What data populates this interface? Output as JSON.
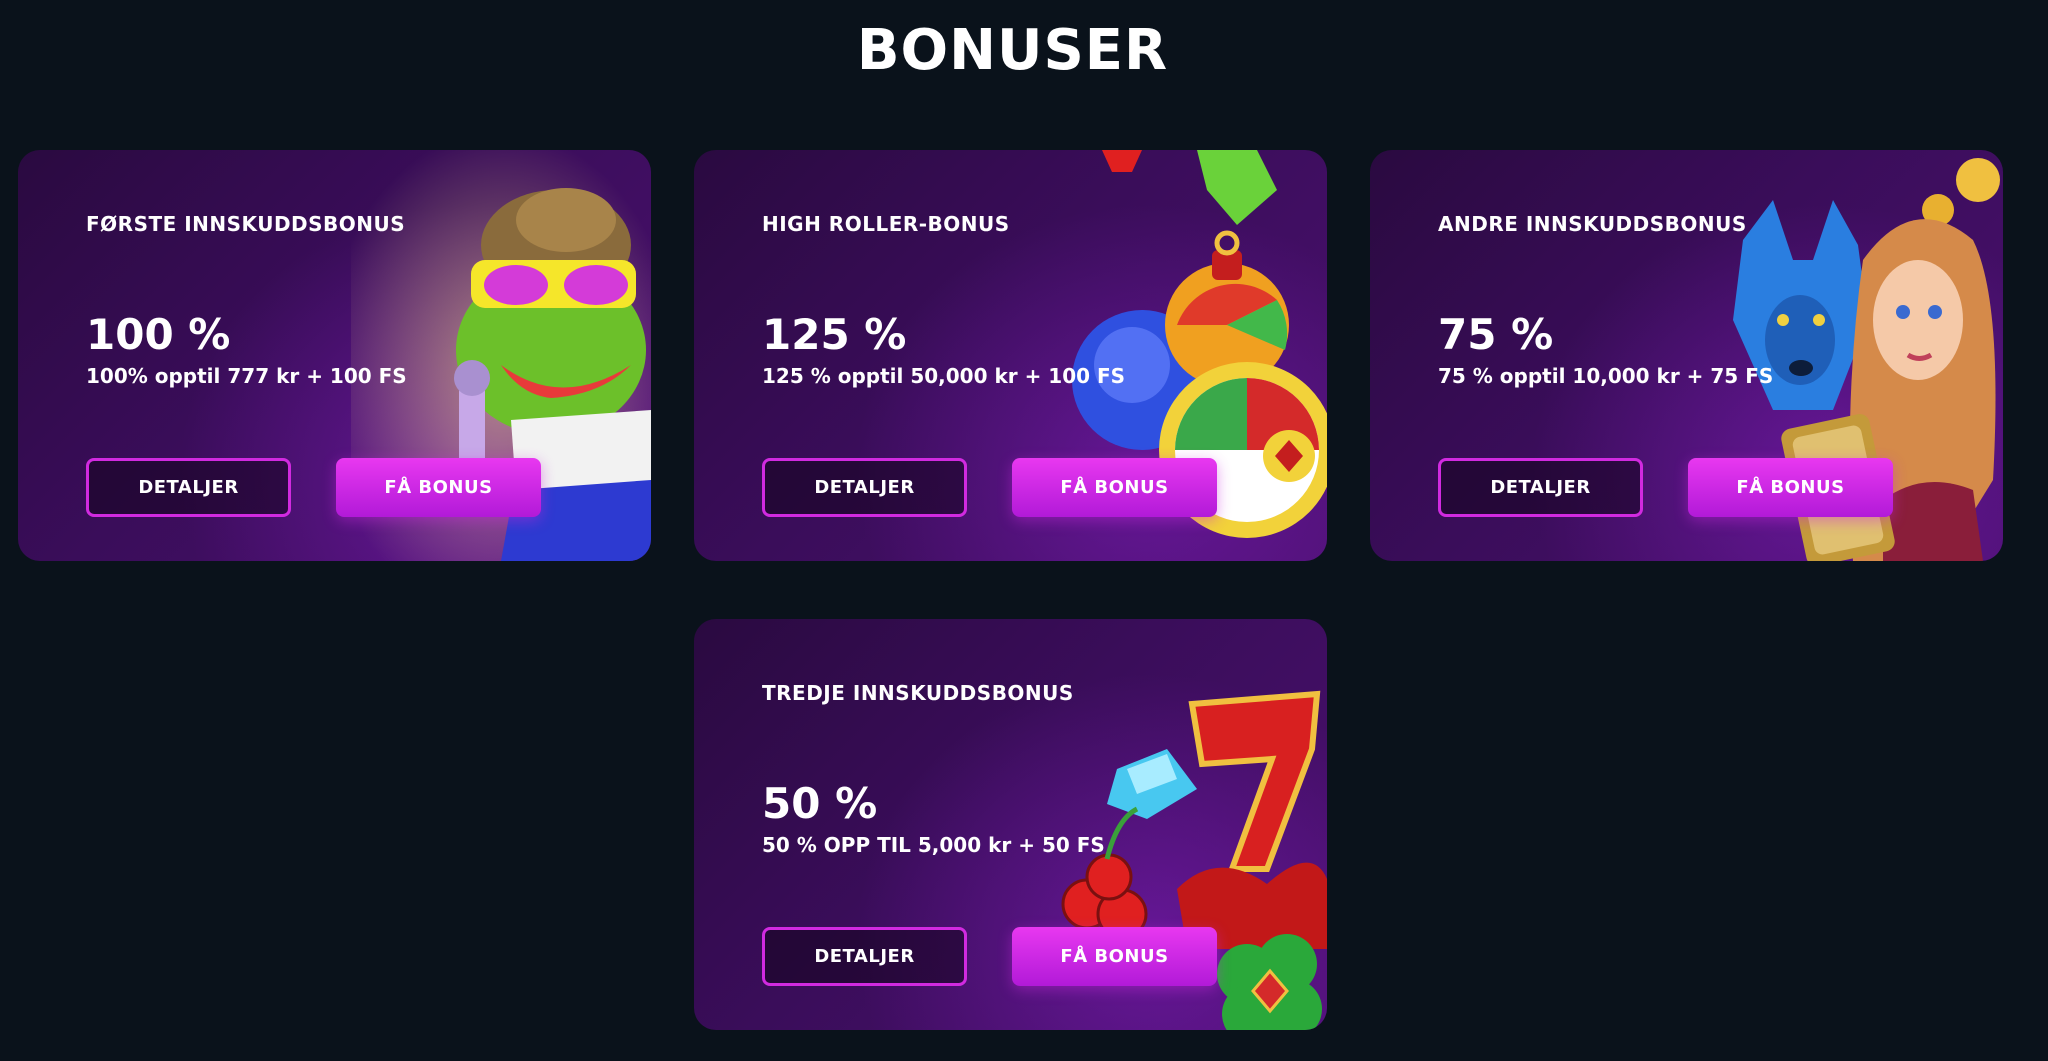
{
  "page": {
    "title": "BONUSER"
  },
  "bonuses": [
    {
      "name": "FØRSTE INNSKUDDSBONUS",
      "percent": "100 %",
      "description": "100% opptil 777 kr + 100 FS",
      "details_label": "DETALJER",
      "get_label": "FÅ BONUS",
      "art": "frog-singer-slot-art"
    },
    {
      "name": "HIGH ROLLER-BONUS",
      "percent": "125 %",
      "description": "125 % opptil 50,000 kr + 100 FS",
      "details_label": "DETALJER",
      "get_label": "FÅ BONUS",
      "art": "gems-candy-slot-art"
    },
    {
      "name": "ANDRE INNSKUDDSBONUS",
      "percent": "75 %",
      "description": "75 % opptil 10,000 kr + 75 FS",
      "details_label": "DETALJER",
      "get_label": "FÅ BONUS",
      "art": "wolf-princess-slot-art"
    },
    {
      "name": "TREDJE INNSKUDDSBONUS",
      "percent": "50 %",
      "description": "50 % OPP TIL 5,000 kr + 50 FS",
      "details_label": "DETALJER",
      "get_label": "FÅ BONUS",
      "art": "lucky-seven-cherries-art"
    }
  ],
  "colors": {
    "background": "#0a121b",
    "card_gradient_start": "#2a0a40",
    "card_gradient_end": "#4b1070",
    "accent_magenta": "#d12ae0",
    "button_gradient_top": "#e838f0",
    "button_gradient_bottom": "#b21ad8"
  }
}
